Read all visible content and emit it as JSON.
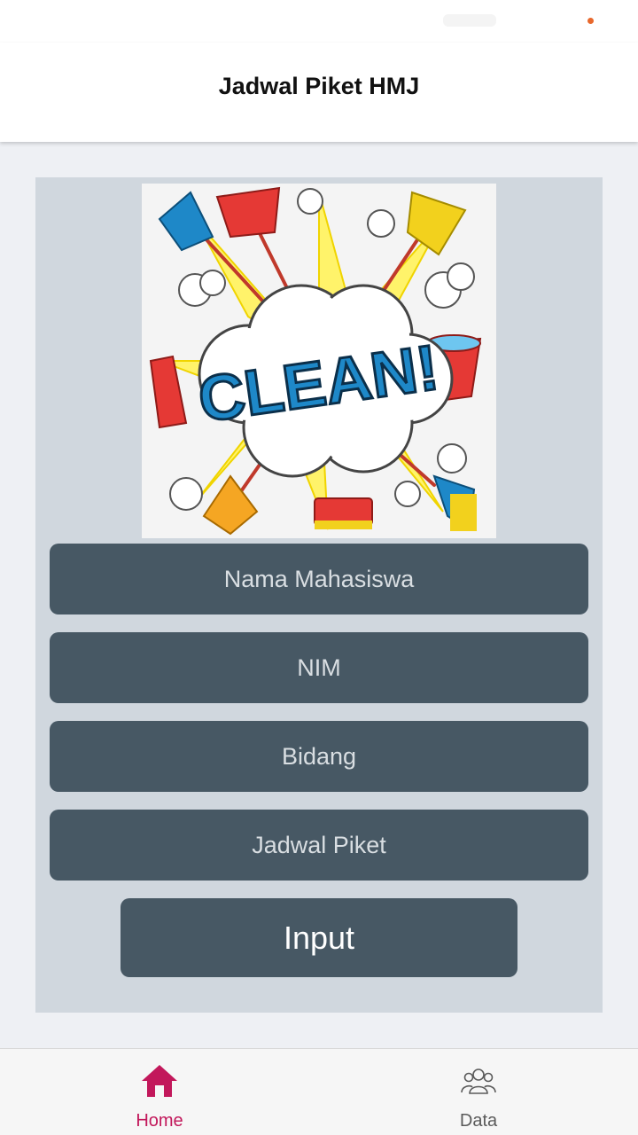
{
  "app_bar": {
    "title": "Jadwal Piket HMJ"
  },
  "hero": {
    "text": "CLEAN!"
  },
  "form": {
    "nama_placeholder": "Nama Mahasiswa",
    "nim_placeholder": "NIM",
    "bidang_placeholder": "Bidang",
    "jadwal_placeholder": "Jadwal Piket",
    "submit_label": "Input"
  },
  "bottom_nav": {
    "items": [
      {
        "label": "Home",
        "icon": "home-icon",
        "active": true,
        "color": "#c2185b"
      },
      {
        "label": "Data",
        "icon": "people-icon",
        "active": false,
        "color": "#5a5a5a"
      }
    ]
  },
  "colors": {
    "field_bg": "#475864",
    "panel_bg": "#d0d7de",
    "accent": "#c2185b"
  }
}
